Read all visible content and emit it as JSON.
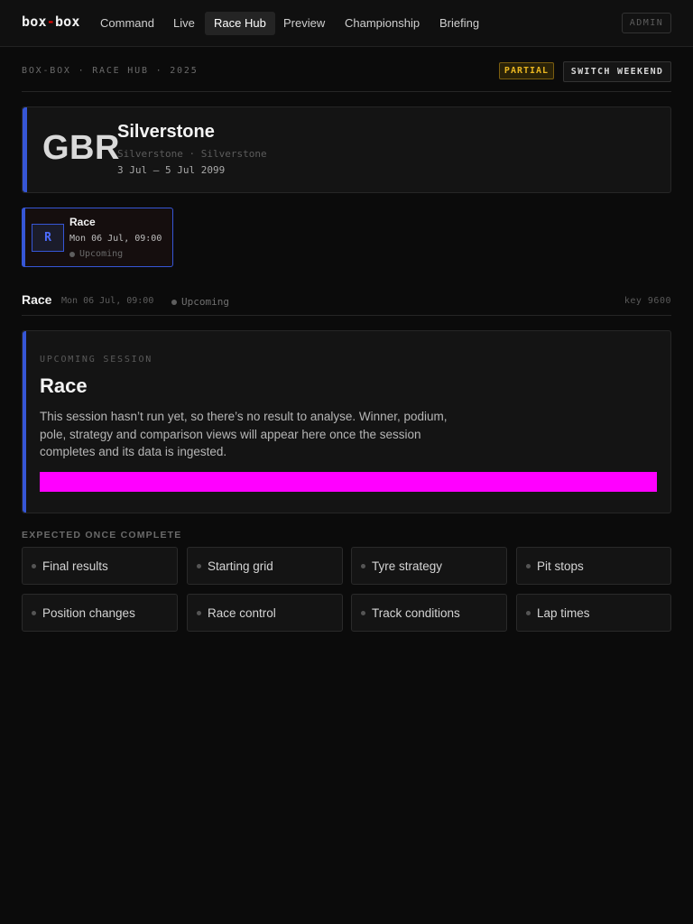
{
  "nav": {
    "logo_left": "box",
    "logo_sep": "-",
    "logo_right": "box",
    "items": [
      "Command",
      "Live",
      "Race Hub",
      "Preview",
      "Championship",
      "Briefing"
    ],
    "active": "Race Hub",
    "admin_label": "ADMIN"
  },
  "header": {
    "breadcrumb": "BOX-BOX · RACE HUB · 2025",
    "badge": "PARTIAL",
    "switch_label": "SWITCH WEEKEND"
  },
  "event": {
    "code": "GBR",
    "name": "Silverstone",
    "subtitle": "Silverstone · Silverstone",
    "dates": "3 Jul – 5 Jul 2099"
  },
  "session_tile": {
    "letter": "R",
    "name": "Race",
    "time": "Mon 06 Jul, 09:00",
    "status": "Upcoming"
  },
  "session_header": {
    "title": "Race",
    "time": "Mon 06 Jul, 09:00",
    "status": "Upcoming",
    "key": "key 9600"
  },
  "upcoming": {
    "eyebrow": "UPCOMING SESSION",
    "title": "Race",
    "body": "This session hasn’t run yet, so there’s no result to analyse. Winner, podium, pole, strategy and comparison views will appear here once the session completes and its data is ingested."
  },
  "expected": {
    "label": "EXPECTED ONCE COMPLETE",
    "items": [
      "Final results",
      "Starting grid",
      "Tyre strategy",
      "Pit stops",
      "Position changes",
      "Race control",
      "Track conditions",
      "Lap times"
    ]
  },
  "colors": {
    "accent": "#3656d6",
    "partial": "#e9b621",
    "placeholder_bar": "#ff00ff"
  }
}
